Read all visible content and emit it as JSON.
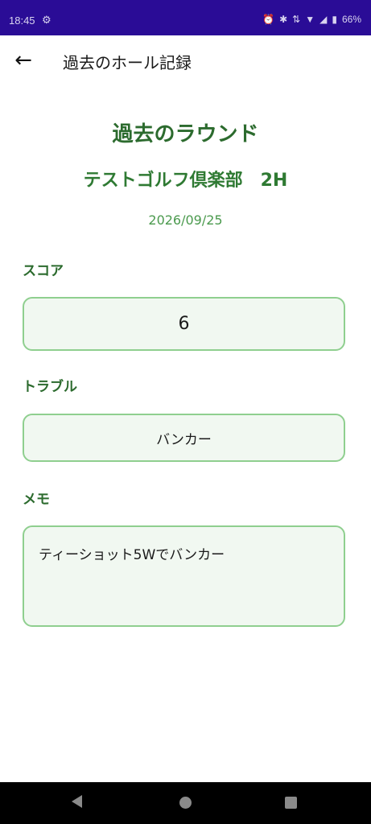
{
  "status_bar": {
    "time": "18:45",
    "battery": "66%",
    "background_color": "#2a0c96"
  },
  "app_bar": {
    "title": "過去のホール記録"
  },
  "header": {
    "title": "過去のラウンド",
    "course": "テストゴルフ倶楽部　2H",
    "date": "2026/09/25"
  },
  "score": {
    "label": "スコア",
    "value": "6"
  },
  "trouble": {
    "label": "トラブル",
    "value": "バンカー"
  },
  "memo": {
    "label": "メモ",
    "value": "ティーショット5Wでバンカー"
  },
  "colors": {
    "accent": "#2c6b2e",
    "field_border": "#8fcf8f",
    "field_bg": "#f1f8f1"
  }
}
